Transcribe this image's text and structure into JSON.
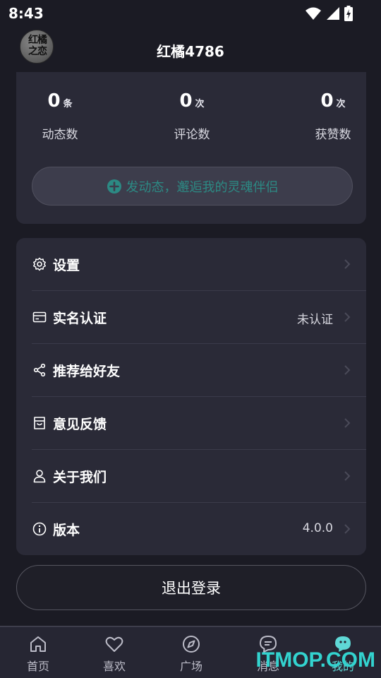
{
  "status_bar": {
    "time": "8:43"
  },
  "header": {
    "title": "红橘4786",
    "avatar_text_line1": "红橘",
    "avatar_text_line2": "之恋"
  },
  "stats": [
    {
      "value": "0",
      "unit": "条",
      "label": "动态数"
    },
    {
      "value": "0",
      "unit": "次",
      "label": "评论数"
    },
    {
      "value": "0",
      "unit": "次",
      "label": "获赞数"
    }
  ],
  "post_button": {
    "label": "发动态，邂逅我的灵魂伴侣"
  },
  "menu": [
    {
      "label": "设置",
      "value": "",
      "icon": "gear-icon"
    },
    {
      "label": "实名认证",
      "value": "未认证",
      "icon": "id-card-icon"
    },
    {
      "label": "推荐给好友",
      "value": "",
      "icon": "share-icon"
    },
    {
      "label": "意见反馈",
      "value": "",
      "icon": "feedback-icon"
    },
    {
      "label": "关于我们",
      "value": "",
      "icon": "person-icon"
    },
    {
      "label": "版本",
      "value": "4.0.0",
      "icon": "info-icon"
    }
  ],
  "logout": {
    "label": "退出登录"
  },
  "bottom_nav": [
    {
      "label": "首页",
      "icon": "home-icon",
      "active": false
    },
    {
      "label": "喜欢",
      "icon": "heart-icon",
      "active": false
    },
    {
      "label": "广场",
      "icon": "compass-icon",
      "active": false
    },
    {
      "label": "消息",
      "icon": "message-icon",
      "active": false
    },
    {
      "label": "我的",
      "icon": "profile-face-icon",
      "active": true
    }
  ],
  "watermark": "ITMOP.COM",
  "colors": {
    "accent": "#5fd8d6",
    "background": "#1b1b24",
    "card": "#2a2a37",
    "post_text": "#2c8a84"
  }
}
